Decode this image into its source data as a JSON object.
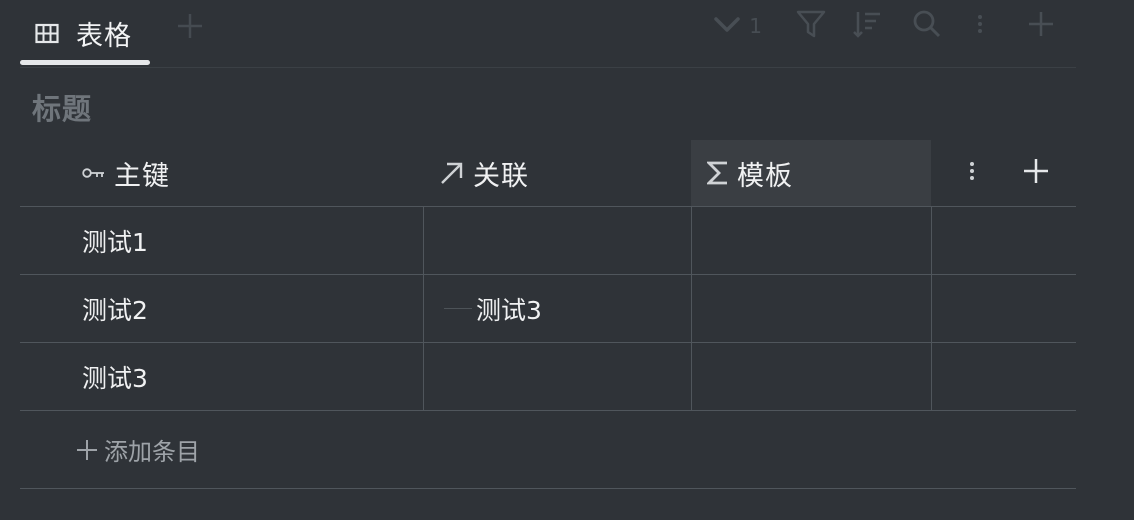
{
  "tabs": [
    {
      "label": "表格",
      "icon": "table-grid-icon",
      "active": true
    }
  ],
  "toolbar": {
    "filter_count": "1",
    "icons": [
      "chevron-down-icon",
      "filter-icon",
      "sort-icon",
      "search-icon",
      "more-vertical-icon",
      "plus-icon"
    ]
  },
  "view": {
    "title": "标题"
  },
  "table": {
    "columns": [
      {
        "label": "主键",
        "icon": "key-icon"
      },
      {
        "label": "关联",
        "icon": "relation-arrow-icon"
      },
      {
        "label": "模板",
        "icon": "sigma-icon"
      }
    ],
    "rows": [
      {
        "key": "测试1",
        "relation": "",
        "template": ""
      },
      {
        "key": "测试2",
        "relation": "测试3",
        "template": ""
      },
      {
        "key": "测试3",
        "relation": "",
        "template": ""
      }
    ],
    "add_row_label": "添加条目"
  },
  "colors": {
    "background": "#2f3338",
    "text": "#f0f1f2",
    "muted_title": "#6f757b",
    "toolbar_icon": "#484e54",
    "grid_line": "#50565c",
    "highlight_header": "#3a3e43"
  }
}
